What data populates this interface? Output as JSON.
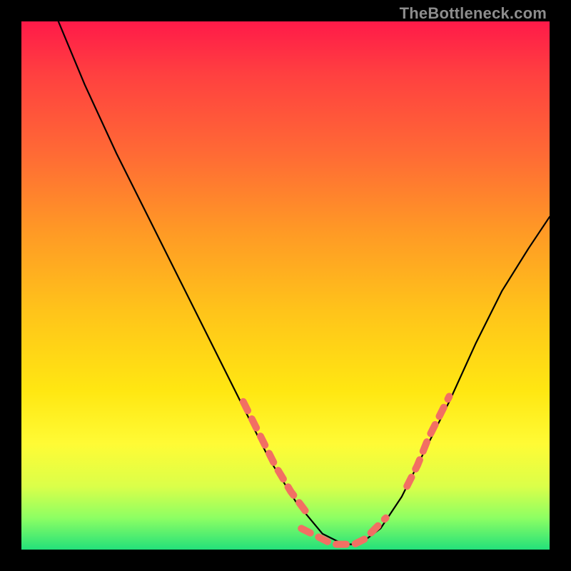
{
  "watermark": {
    "text": "TheBottleneck.com"
  },
  "chart_data": {
    "type": "line",
    "title": "",
    "xlabel": "",
    "ylabel": "",
    "xlim": [
      0,
      100
    ],
    "ylim": [
      0,
      100
    ],
    "grid": false,
    "legend": false,
    "annotations": [],
    "series": [
      {
        "name": "curve",
        "color": "#000000",
        "x": [
          7,
          12,
          18,
          24,
          30,
          36,
          42,
          47,
          52,
          57,
          61,
          64,
          68,
          72,
          76,
          81,
          86,
          91,
          96,
          100
        ],
        "values": [
          100,
          88,
          75,
          63,
          51,
          39,
          27,
          17,
          9,
          3,
          1,
          1,
          4,
          10,
          18,
          28,
          39,
          49,
          57,
          63
        ]
      },
      {
        "name": "highlight-left",
        "color": "#f26f63",
        "style": "dashed",
        "x": [
          42,
          45,
          48,
          51,
          54
        ],
        "values": [
          28,
          22,
          16,
          11,
          7
        ]
      },
      {
        "name": "highlight-bottom",
        "color": "#f26f63",
        "style": "dashed",
        "x": [
          53,
          55,
          57,
          59,
          61,
          63,
          65,
          67,
          69
        ],
        "values": [
          4,
          3,
          2,
          1,
          1,
          1,
          2,
          4,
          6
        ]
      },
      {
        "name": "highlight-right",
        "color": "#f26f63",
        "style": "dashed",
        "x": [
          73,
          75,
          77,
          79,
          81
        ],
        "values": [
          12,
          16,
          21,
          25,
          29
        ]
      }
    ]
  }
}
